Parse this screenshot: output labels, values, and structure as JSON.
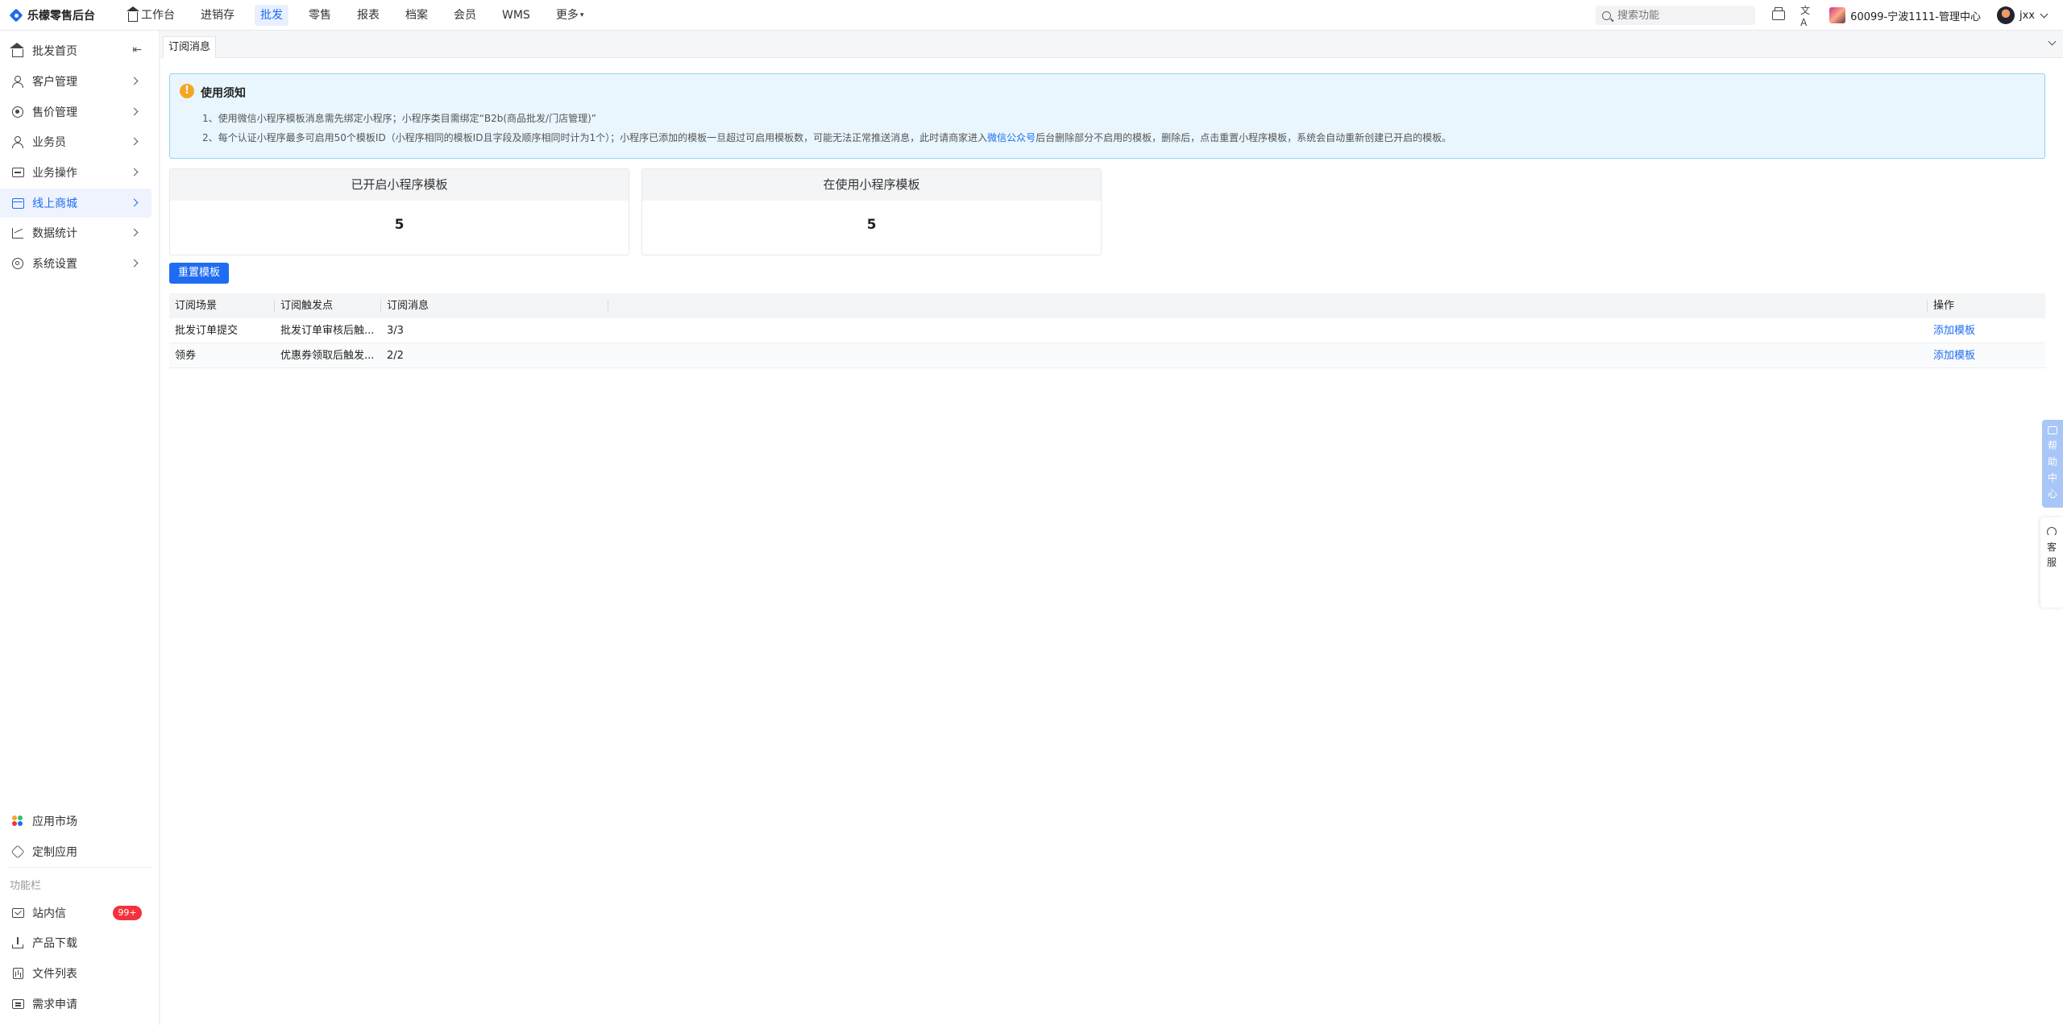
{
  "app": {
    "title": "乐檬零售后台"
  },
  "nav": [
    {
      "label": "工作台",
      "active": false
    },
    {
      "label": "进销存",
      "active": false
    },
    {
      "label": "批发",
      "active": true
    },
    {
      "label": "零售",
      "active": false
    },
    {
      "label": "报表",
      "active": false
    },
    {
      "label": "档案",
      "active": false
    },
    {
      "label": "会员",
      "active": false
    },
    {
      "label": "WMS",
      "active": false
    },
    {
      "label": "更多",
      "active": false
    }
  ],
  "header": {
    "search_placeholder": "搜索功能",
    "translate_glyph": "文A",
    "store": "60099-宁波1111-管理中心",
    "user": "jxx"
  },
  "sidebar": {
    "items": [
      {
        "label": "批发首页"
      },
      {
        "label": "客户管理"
      },
      {
        "label": "售价管理"
      },
      {
        "label": "业务员"
      },
      {
        "label": "业务操作"
      },
      {
        "label": "线上商城"
      },
      {
        "label": "数据统计"
      },
      {
        "label": "系统设置"
      }
    ],
    "collapse_glyph": "⇤",
    "bottom": [
      {
        "label": "应用市场"
      },
      {
        "label": "定制应用"
      }
    ],
    "section_title": "功能栏",
    "tools": [
      {
        "label": "站内信",
        "badge": "99+"
      },
      {
        "label": "产品下载"
      },
      {
        "label": "文件列表"
      },
      {
        "label": "需求申请"
      }
    ]
  },
  "tabs": [
    {
      "label": "订阅消息"
    }
  ],
  "notice": {
    "icon": "!",
    "title": "使用须知",
    "line1": "1、使用微信小程序模板消息需先绑定小程序；小程序类目需绑定“B2b(商品批发/门店管理)”",
    "line2_a": "2、每个认证小程序最多可启用50个模板ID（小程序相同的模板ID且字段及顺序相同时计为1个）；小程序已添加的模板一旦超过可启用模板数，可能无法正常推送消息，此时请商家进入",
    "line2_link": "微信公众号",
    "line2_b": "后台删除部分不启用的模板，删除后，点击重置小程序模板，系统会自动重新创建已开启的模板。"
  },
  "stats": [
    {
      "title": "已开启小程序模板",
      "value": "5"
    },
    {
      "title": "在使用小程序模板",
      "value": "5"
    }
  ],
  "reset_button": "重置模板",
  "table": {
    "headers": [
      "订阅场景",
      "订阅触发点",
      "订阅消息",
      "操作"
    ],
    "rows": [
      {
        "scene": "批发订单提交",
        "trigger": "批发订单审核后触...",
        "msg": "3/3",
        "action": "添加模板"
      },
      {
        "scene": "领券",
        "trigger": "优惠券领取后触发...",
        "msg": "2/2",
        "action": "添加模板"
      }
    ]
  },
  "float": {
    "help": [
      "帮",
      "助",
      "中",
      "心"
    ],
    "service": [
      "客",
      "服"
    ]
  }
}
